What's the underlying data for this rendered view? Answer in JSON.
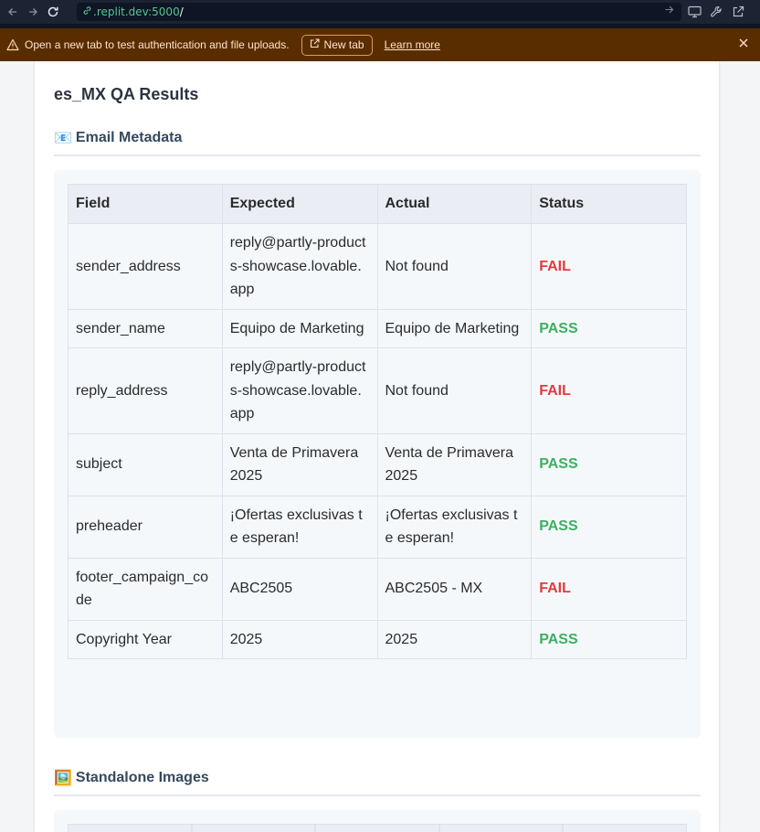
{
  "browser": {
    "url_host": ".replit.dev:5000",
    "url_path": "/"
  },
  "banner": {
    "message": "Open a new tab to test authentication and file uploads.",
    "new_tab_label": "New tab",
    "learn_more_label": "Learn more"
  },
  "page": {
    "title": "es_MX QA Results"
  },
  "email_metadata": {
    "emoji": "📧",
    "title": "Email Metadata",
    "columns": [
      "Field",
      "Expected",
      "Actual",
      "Status"
    ],
    "rows": [
      {
        "field": "sender_address",
        "expected": "reply@partly-products-showcase.lovable.app",
        "actual": "Not found",
        "status": "FAIL"
      },
      {
        "field": "sender_name",
        "expected": "Equipo de Marketing",
        "actual": "Equipo de Marketing",
        "status": "PASS"
      },
      {
        "field": "reply_address",
        "expected": "reply@partly-products-showcase.lovable.app",
        "actual": "Not found",
        "status": "FAIL"
      },
      {
        "field": "subject",
        "expected": "Venta de Primavera 2025",
        "actual": "Venta de Primavera 2025",
        "status": "PASS"
      },
      {
        "field": "preheader",
        "expected": "¡Ofertas exclusivas te esperan!",
        "actual": "¡Ofertas exclusivas te esperan!",
        "status": "PASS"
      },
      {
        "field": "footer_campaign_code",
        "expected": "ABC2505",
        "actual": "ABC2505 - MX",
        "status": "FAIL"
      },
      {
        "field": "Copyright Year",
        "expected": "2025",
        "actual": "2025",
        "status": "PASS"
      }
    ]
  },
  "standalone_images": {
    "emoji": "🖼️",
    "title": "Standalone Images"
  },
  "colors": {
    "fail": "#e23b3b",
    "pass": "#3cb060",
    "banner_bg": "#5a2d00",
    "url_green": "#58c48e"
  }
}
